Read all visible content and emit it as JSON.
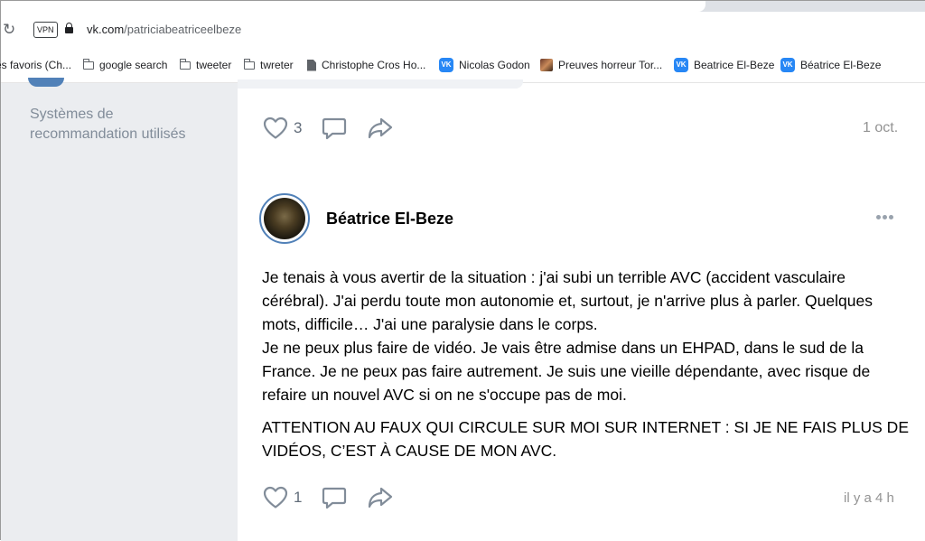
{
  "browser": {
    "vpn_label": "VPN",
    "url_domain": "vk.com",
    "url_path": "/patriciabeatriceelbeze"
  },
  "bookmarks": [
    {
      "label": "es favoris (Ch...",
      "icon": "none"
    },
    {
      "label": "google search",
      "icon": "folder-icon"
    },
    {
      "label": "tweeter",
      "icon": "folder-icon"
    },
    {
      "label": "twreter",
      "icon": "folder-icon"
    },
    {
      "label": "Christophe Cros Ho...",
      "icon": "document-icon"
    },
    {
      "label": "Nicolas Godon",
      "icon": "vk-icon"
    },
    {
      "label": "Preuves horreur Tor...",
      "icon": "thumbnail-icon"
    },
    {
      "label": "Beatrice El-Beze",
      "icon": "vk-icon"
    },
    {
      "label": "Béatrice El-Beze",
      "icon": "vk-icon"
    }
  ],
  "sidebar": {
    "recommendation_label": "Systèmes de recommandation utilisés"
  },
  "previous_post": {
    "likes": "3",
    "date": "1 oct."
  },
  "post": {
    "author": "Béatrice El-Beze",
    "paragraph1": "Je tenais à vous avertir de la situation : j'ai subi un terrible AVC (accident vasculaire cérébral). J'ai perdu toute mon autonomie et, surtout, je n'arrive plus à parler. Quelques mots, difficile… J'ai une paralysie dans le corps.",
    "paragraph1b": "Je ne peux plus faire de vidéo. Je vais être admise dans un EHPAD, dans le sud de la France. Je ne peux pas faire autrement. Je suis une vieille dépendante, avec risque de refaire un nouvel AVC si on ne s'occupe pas de moi.",
    "paragraph2": "ATTENTION AU FAUX QUI CIRCULE SUR MOI SUR INTERNET : SI JE NE FAIS PLUS DE VIDÉOS, C’EST À CAUSE DE MON AVC.",
    "likes": "1",
    "date": "il y a 4 h"
  },
  "colors": {
    "vk_blue": "#2787f5",
    "accent": "#5181b8",
    "sidebar_bg": "#ebedf0",
    "icon_gray": "#818c99"
  }
}
